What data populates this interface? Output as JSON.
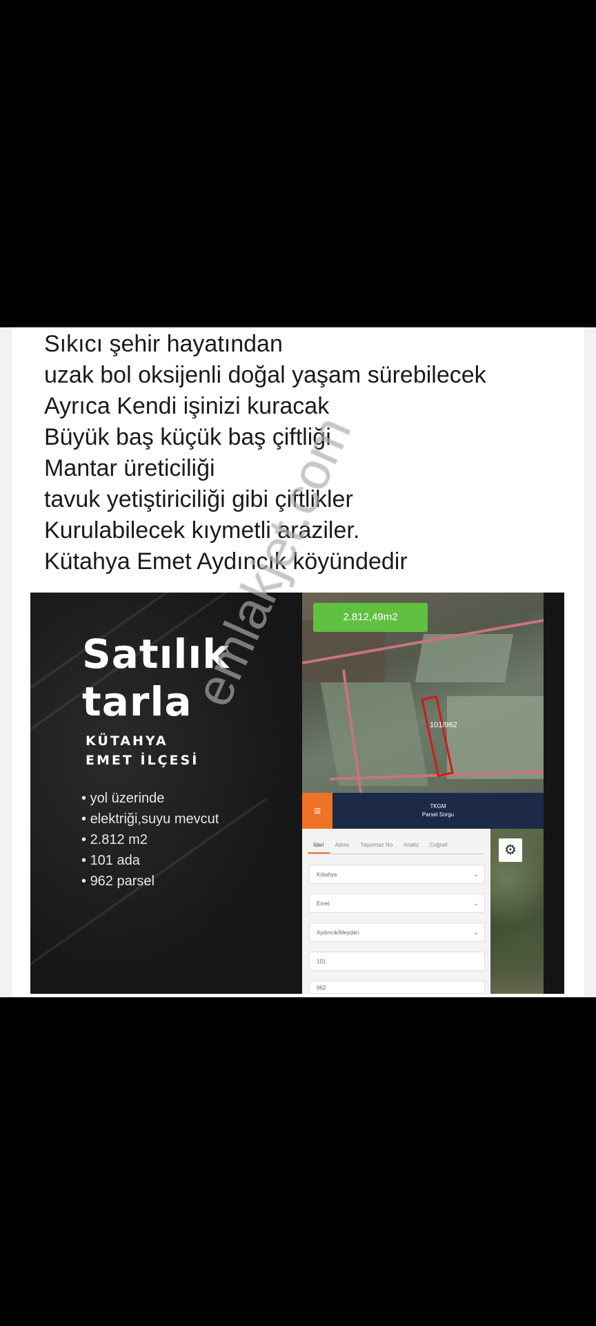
{
  "post": {
    "lines": [
      "Sıkıcı şehir hayatından",
      "uzak bol oksijenli doğal yaşam sürebilecek",
      "Ayrıca Kendi işinizi kuracak",
      "Büyük baş küçük baş çiftliği",
      "Mantar üreticiliği",
      "tavuk yetiştiriciliği gibi çiftlikler",
      "Kurulabilecek kıymetli araziler.",
      "Kütahya Emet Aydıncık köyündedir"
    ]
  },
  "ad": {
    "headline_1": "Satılık",
    "headline_2": "tarla",
    "subline_1": "KÜTAHYA",
    "subline_2": "EMET İLÇESİ",
    "bullets": [
      "yol üzerinde",
      "elektriği,suyu mevcut",
      "2.812 m2",
      "101 ada",
      "962 parsel"
    ],
    "map": {
      "area_label": "2.812,49m2",
      "parcel_label": "101/962"
    },
    "app": {
      "title_1": "TKGM",
      "title_2": "Parsel Sorgu",
      "menu_icon": "menu-icon",
      "tabs": [
        "İdari",
        "Adres",
        "Taşınmaz No",
        "Analiz",
        "Coğrafi"
      ],
      "fields": [
        "Kütahya",
        "Emet",
        "Aydıncık/Meydan",
        "101",
        "962"
      ],
      "settings_icon": "gear-icon"
    }
  },
  "watermark": "emlakjet.com",
  "colors": {
    "area_badge": "#5fc13f",
    "menu_button": "#f07226",
    "app_header": "#1c2a48",
    "parcel_outline": "#d21a1a"
  }
}
